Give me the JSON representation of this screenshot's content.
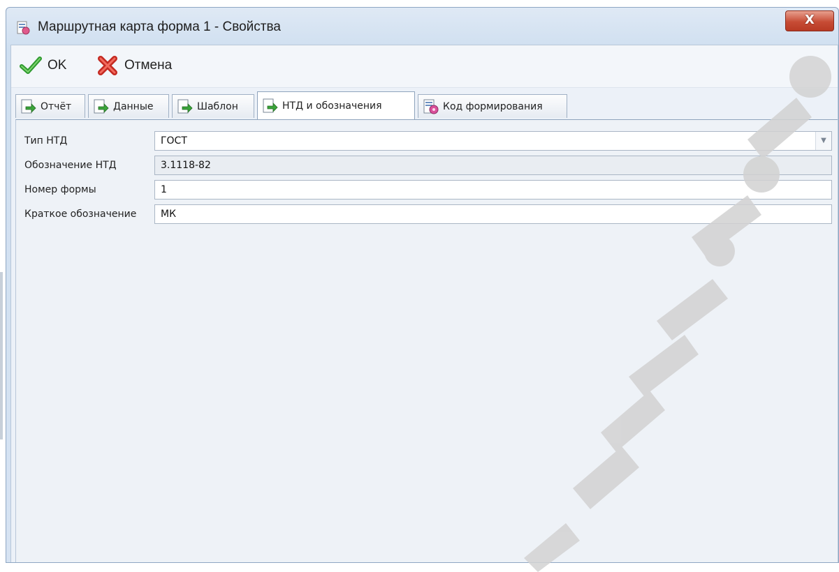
{
  "window": {
    "title": "Маршрутная карта форма 1 - Свойства",
    "close_label": "X"
  },
  "toolbar": {
    "ok_label": "OK",
    "cancel_label": "Отмена"
  },
  "tabs": [
    {
      "label": "Отчёт",
      "icon": "report-icon"
    },
    {
      "label": "Данные",
      "icon": "data-icon"
    },
    {
      "label": "Шаблон",
      "icon": "template-icon"
    },
    {
      "label": "НТД и обозначения",
      "icon": "document-icon",
      "active": true
    },
    {
      "label": "Код формирования",
      "icon": "code-icon"
    }
  ],
  "form": {
    "ntd_type": {
      "label": "Тип НТД",
      "value": "ГОСТ"
    },
    "ntd_designation": {
      "label": "Обозначение НТД",
      "value": "3.1118-82"
    },
    "form_number": {
      "label": "Номер формы",
      "value": "1"
    },
    "short_designation": {
      "label": "Краткое обозначение",
      "value": "МК"
    }
  },
  "colors": {
    "ok_green": "#3aa43a",
    "cancel_red": "#d9322a",
    "close_red": "#c74c35",
    "watermark": "#cfcfcf"
  }
}
